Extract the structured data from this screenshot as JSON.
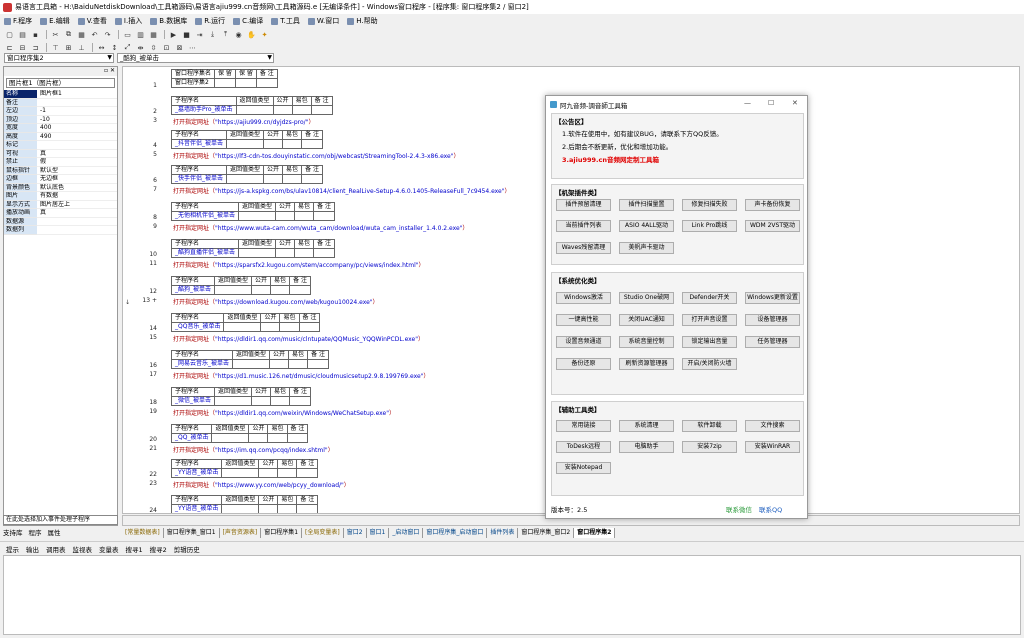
{
  "window": {
    "title": "易语言工具箱 - H:\\BaiduNetdiskDownload\\工具箱源码\\易语言ajiu999.cn音频网\\工具箱源码.e [无编译条件] - Windows窗口程序 - [程序集: 窗口程序集2 / 窗口2]"
  },
  "menu": [
    {
      "label": "F.程序"
    },
    {
      "label": "E.编辑"
    },
    {
      "label": "V.查看"
    },
    {
      "label": "I.插入"
    },
    {
      "label": "B.数据库"
    },
    {
      "label": "R.运行"
    },
    {
      "label": "C.编译"
    },
    {
      "label": "T.工具"
    },
    {
      "label": "W.窗口"
    },
    {
      "label": "H.帮助"
    }
  ],
  "selectors": {
    "left": "窗口程序集2",
    "right": "_酷狗_被单击"
  },
  "left_panel": {
    "object_select": "图片框1（图片框）",
    "properties": [
      {
        "k": "名称",
        "v": "图片框1"
      },
      {
        "k": "备注",
        "v": ""
      },
      {
        "k": "左边",
        "v": "-1"
      },
      {
        "k": "顶边",
        "v": "-10"
      },
      {
        "k": "宽度",
        "v": "400"
      },
      {
        "k": "高度",
        "v": "490"
      },
      {
        "k": "标记",
        "v": ""
      },
      {
        "k": "可视",
        "v": "真"
      },
      {
        "k": "禁止",
        "v": "假"
      },
      {
        "k": "鼠标指针",
        "v": "默认型"
      },
      {
        "k": "边框",
        "v": "无边框"
      },
      {
        "k": "背景颜色",
        "v": "默认底色"
      },
      {
        "k": "图片",
        "v": "有数据"
      },
      {
        "k": "显示方式",
        "v": "图片居左上"
      },
      {
        "k": "播放动画",
        "v": "真"
      },
      {
        "k": "数据源",
        "v": ""
      },
      {
        "k": "数据列",
        "v": ""
      }
    ],
    "event_select": "在此处选择加入事件处理子程序",
    "tabs": [
      "支持库",
      "程序",
      "属性"
    ]
  },
  "code": {
    "header": {
      "line": "1",
      "cols": [
        "窗口程序集名",
        "保 留",
        "保 留",
        "备 注"
      ],
      "values": [
        "窗口程序集2",
        "",
        "",
        ""
      ]
    },
    "blocks": [
      {
        "ln_sub": "2",
        "ln_call": "3",
        "name": "_墓墙助手Pro_被单击",
        "url": "\"https://ajiu999.cn/dyjdzs-pro/\""
      },
      {
        "ln_sub": "4",
        "ln_call": "5",
        "name": "_抖音伴侣_被单击",
        "url": "\"https://lf3-cdn-tos.douyinstatic.com/obj/webcast/StreamingTool-2.4.3-x86.exe\""
      },
      {
        "ln_sub": "6",
        "ln_call": "7",
        "name": "_快手伴侣_被单击",
        "url": "\"https://js-a.kspkg.com/bs/ulav10814/client_RealLive-Setup-4.6.0.1405-ReleaseFull_7c9454.exe\""
      },
      {
        "ln_sub": "8",
        "ln_call": "9",
        "name": "_无他相机伴侣_被单击",
        "url": "\"https://www.wuta-cam.com/wuta_cam/download/wuta_cam_installer_1.4.0.2.exe\""
      },
      {
        "ln_sub": "10",
        "ln_call": "11",
        "name": "_酷狗直播伴侣_被单击",
        "url": "\"https://sparsfx2.kugou.com/stem/accompany/pc/views/index.html\""
      },
      {
        "ln_sub": "12",
        "ln_call": "13 +",
        "name": "_酷狗_被单击",
        "url": "\"https://download.kugou.com/web/kugou10024.exe\""
      },
      {
        "ln_sub": "14",
        "ln_call": "15",
        "name": "_QQ音乐_被单击",
        "url": "\"https://dldir1.qq.com/music/clntupate/QQMusic_YQQWinPCDL.exe\""
      },
      {
        "ln_sub": "16",
        "ln_call": "17",
        "name": "_网易云音乐_被单击",
        "url": "\"https://d1.music.126.net/dmusic/cloudmusicsetup2.9.8.199769.exe\""
      },
      {
        "ln_sub": "18",
        "ln_call": "19",
        "name": "_微信_被单击",
        "url": "\"https://dldir1.qq.com/weixin/Windows/WeChatSetup.exe\""
      },
      {
        "ln_sub": "20",
        "ln_call": "21",
        "name": "_QQ_被单击",
        "url": "\"https://im.qq.com/pcqq/index.shtml\""
      },
      {
        "ln_sub": "22",
        "ln_call": "23",
        "name": "_YY语音_被单击",
        "url": "\"https://www.yy.com/web/pcyy_download/\""
      },
      {
        "ln_sub": "24",
        "ln_call": "",
        "name": "_YY语音_被单击",
        "url": ""
      }
    ],
    "sub_cols": [
      "子程序名",
      "返回值类型",
      "公开",
      "易包",
      "备 注"
    ],
    "call_text": "打开指定网址（",
    "call_end": "）"
  },
  "doc_tabs": [
    "[常量数据表]",
    "窗口程序集_窗口1",
    "[声音资源表]",
    "窗口程序集1",
    "[全局变量表]",
    "窗口2",
    "窗口1",
    "_启动窗口",
    "窗口程序集_启动窗口",
    "插件列表",
    "窗口程序集_窗口2",
    "窗口程序集2"
  ],
  "output_tabs": [
    "提示",
    "输出",
    "调用表",
    "监视表",
    "变量表",
    "搜寻1",
    "搜寻2",
    "剪辑历史"
  ],
  "floatwin": {
    "title": "阿九音频-調音師工具箱",
    "notice_h": "【公告区】",
    "notice": [
      "1.软件在使用中，如有建议BUG，请联系下方QQ反馈。",
      "2.后期会不断更新，优化和增加功能。",
      "3.ajiu999.cn音频网定制工具箱"
    ],
    "notice_color": "#e00000",
    "g1_h": "【机架插件类】",
    "g1": [
      "插件预留清理",
      "插件扫描量置",
      "修复扫描失败",
      "声卡备份恢复",
      "当前插件列表",
      "ASIO 4ALL驱动",
      "Link Pro跳线",
      "WDM 2VST驱动",
      "Waves残留清理",
      "美帆声卡驱动"
    ],
    "g2_h": "【系统优化类】",
    "g2": [
      "Windows激活",
      "Studio One破网",
      "Defender开关",
      "Windows更新设置",
      "一键高性能",
      "关闭UAC通知",
      "打开声音设置",
      "设备管理器",
      "设置音频通道",
      "系统音量控制",
      "锁定输出音量",
      "任务管理器",
      "备份还原",
      "刷新资源管理器",
      "开启/关闭防火墙"
    ],
    "g3_h": "【辅助工具类】",
    "g3": [
      "常用链接",
      "系统清理",
      "软件卸载",
      "文件搜索",
      "ToDesk远程",
      "电脑助手",
      "安装7zip",
      "安装WinRAR",
      "安装Notepad"
    ],
    "version": "版本号：2.5",
    "link1": "联系微信",
    "link2": "联系QQ",
    "link_color": "#2a9a3a",
    "link2_color": "#2060c0"
  }
}
